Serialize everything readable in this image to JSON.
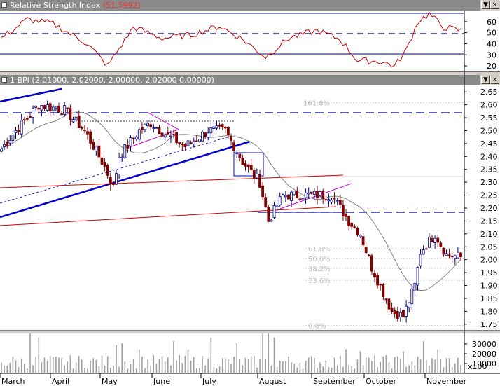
{
  "rsi_panel": {
    "title": "Relative Strength Index",
    "value": "(51.5992)",
    "buttons": [
      "▼",
      "×"
    ],
    "levels": [
      20,
      30,
      40,
      50,
      60
    ]
  },
  "price_panel": {
    "prefix": "1 BPI",
    "ohlc": "(2.01000, 2.02000, 2.00000, 2.02000 0.00000)",
    "buttons": [
      "▼",
      "×"
    ],
    "price_levels": [
      1.75,
      1.8,
      1.85,
      1.9,
      1.95,
      2.0,
      2.05,
      2.1,
      2.15,
      2.2,
      2.25,
      2.3,
      2.35,
      2.4,
      2.45,
      2.5,
      2.55,
      2.6,
      2.65
    ],
    "fib_levels": [
      {
        "label": "161.8%",
        "price": 2.609
      },
      {
        "label": "61.8%",
        "price": 2.043
      },
      {
        "label": "50.0%",
        "price": 2.005
      },
      {
        "label": "38.2%",
        "price": 1.967
      },
      {
        "label": "23.6%",
        "price": 1.92
      },
      {
        "label": "0.0%",
        "price": 1.745
      }
    ]
  },
  "volume_panel": {
    "levels": [
      "30000",
      "20000",
      "10000"
    ],
    "multiplier": "x100"
  },
  "months": [
    "March",
    "April",
    "May",
    "June",
    "July",
    "August",
    "September",
    "October",
    "November"
  ],
  "colors": {
    "up": "#000080",
    "down": "#800000",
    "rsi_line": "#cc0000",
    "trend_blue": "#0000cc",
    "trend_red": "#cc0000",
    "triangle": "#cc00cc"
  },
  "chart_data": {
    "type": "candlestick",
    "ylim": [
      1.725,
      2.675
    ],
    "x_unit": "trading day index (0 = first bar)",
    "price_key_points": [
      {
        "bar": 0,
        "close": 2.43
      },
      {
        "bar": 5,
        "close": 2.5
      },
      {
        "bar": 13,
        "close": 2.6
      },
      {
        "bar": 22,
        "close": 2.58
      },
      {
        "bar": 29,
        "close": 2.5
      },
      {
        "bar": 36,
        "close": 2.36
      },
      {
        "bar": 39,
        "close": 2.28
      },
      {
        "bar": 41,
        "close": 2.4
      },
      {
        "bar": 48,
        "close": 2.5
      },
      {
        "bar": 52,
        "close": 2.53
      },
      {
        "bar": 58,
        "close": 2.48
      },
      {
        "bar": 64,
        "close": 2.44
      },
      {
        "bar": 72,
        "close": 2.5
      },
      {
        "bar": 78,
        "close": 2.5
      },
      {
        "bar": 84,
        "close": 2.38
      },
      {
        "bar": 90,
        "close": 2.3
      },
      {
        "bar": 93,
        "close": 2.15
      },
      {
        "bar": 98,
        "close": 2.25
      },
      {
        "bar": 107,
        "close": 2.25
      },
      {
        "bar": 115,
        "close": 2.25
      },
      {
        "bar": 121,
        "close": 2.15
      },
      {
        "bar": 125,
        "close": 2.1
      },
      {
        "bar": 129,
        "close": 1.97
      },
      {
        "bar": 136,
        "close": 1.8
      },
      {
        "bar": 140,
        "close": 1.78
      },
      {
        "bar": 144,
        "close": 1.9
      },
      {
        "bar": 146,
        "close": 2.03
      },
      {
        "bar": 151,
        "close": 2.1
      },
      {
        "bar": 155,
        "close": 2.02
      },
      {
        "bar": 160,
        "close": 2.01
      }
    ],
    "rsi_key_points": [
      {
        "bar": 0,
        "value": 45
      },
      {
        "bar": 9,
        "value": 62
      },
      {
        "bar": 18,
        "value": 58
      },
      {
        "bar": 30,
        "value": 40
      },
      {
        "bar": 37,
        "value": 20
      },
      {
        "bar": 46,
        "value": 55
      },
      {
        "bar": 56,
        "value": 45
      },
      {
        "bar": 66,
        "value": 48
      },
      {
        "bar": 76,
        "value": 56
      },
      {
        "bar": 84,
        "value": 44
      },
      {
        "bar": 92,
        "value": 28
      },
      {
        "bar": 100,
        "value": 45
      },
      {
        "bar": 110,
        "value": 52
      },
      {
        "bar": 118,
        "value": 44
      },
      {
        "bar": 124,
        "value": 25
      },
      {
        "bar": 132,
        "value": 24
      },
      {
        "bar": 137,
        "value": 20
      },
      {
        "bar": 141,
        "value": 34
      },
      {
        "bar": 145,
        "value": 60
      },
      {
        "bar": 149,
        "value": 67
      },
      {
        "bar": 154,
        "value": 55
      },
      {
        "bar": 160,
        "value": 52
      }
    ],
    "rsi_ylim": [
      15,
      70
    ]
  }
}
